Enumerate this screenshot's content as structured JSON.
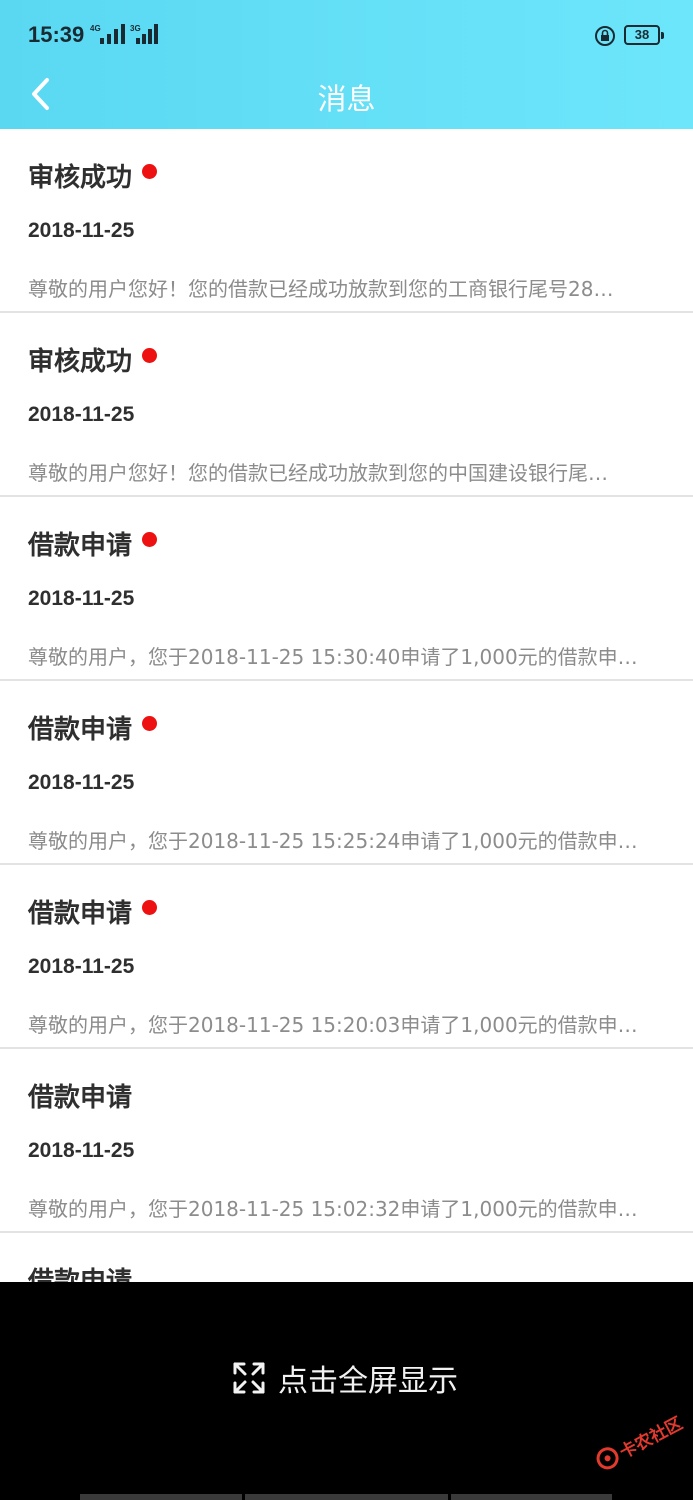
{
  "status_bar": {
    "time": "15:39",
    "network_1": "4G",
    "network_2": "3G",
    "battery": "38"
  },
  "nav": {
    "back_icon": "chevron-left-icon",
    "title": "消息"
  },
  "messages": [
    {
      "title": "审核成功",
      "unread": true,
      "date": "2018-11-25",
      "body": "尊敬的用户您好！您的借款已经成功放款到您的工商银行尾号28…"
    },
    {
      "title": "审核成功",
      "unread": true,
      "date": "2018-11-25",
      "body": "尊敬的用户您好！您的借款已经成功放款到您的中国建设银行尾…"
    },
    {
      "title": "借款申请",
      "unread": true,
      "date": "2018-11-25",
      "body": "尊敬的用户，您于2018-11-25 15:30:40申请了1,000元的借款申…"
    },
    {
      "title": "借款申请",
      "unread": true,
      "date": "2018-11-25",
      "body": "尊敬的用户，您于2018-11-25 15:25:24申请了1,000元的借款申…"
    },
    {
      "title": "借款申请",
      "unread": true,
      "date": "2018-11-25",
      "body": "尊敬的用户，您于2018-11-25 15:20:03申请了1,000元的借款申…"
    },
    {
      "title": "借款申请",
      "unread": false,
      "date": "2018-11-25",
      "body": "尊敬的用户，您于2018-11-25 15:02:32申请了1,000元的借款申…"
    },
    {
      "title": "借款申请",
      "unread": false,
      "date": "",
      "body": ""
    }
  ],
  "overlay": {
    "fullscreen_label": "点击全屏显示",
    "fullscreen_icon": "expand-icon"
  },
  "watermark": {
    "text": "卡农社区"
  },
  "colors": {
    "header_start": "#5ad8f2",
    "header_end": "#6de6fb",
    "unread_dot": "#ee1111",
    "body_text": "#8c8c8c"
  }
}
